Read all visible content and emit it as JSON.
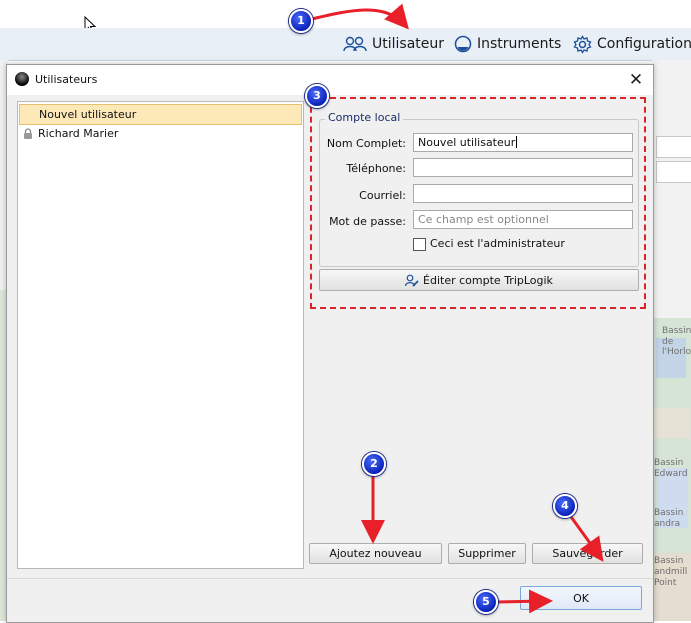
{
  "app_toolbar": {
    "items": [
      {
        "label": "Utilisateur",
        "icon": "users-icon"
      },
      {
        "label": "Instruments",
        "icon": "instrument-icon"
      },
      {
        "label": "Configuration",
        "icon": "gear-icon"
      }
    ]
  },
  "dialog": {
    "title": "Utilisateurs",
    "close_icon": "close-icon",
    "users": [
      {
        "name": "Nouvel utilisateur",
        "selected": true
      },
      {
        "name": "Richard Marier",
        "locked": true
      }
    ],
    "group_label": "Compte local",
    "fields": {
      "full_name": {
        "label": "Nom Complet:",
        "value": "Nouvel utilisateur"
      },
      "phone": {
        "label": "Téléphone:",
        "value": ""
      },
      "email": {
        "label": "Courriel:",
        "value": ""
      },
      "password": {
        "label": "Mot de passe:",
        "placeholder": "Ce champ est optionnel"
      }
    },
    "admin_checkbox": {
      "label": "Ceci est l'administrateur",
      "checked": false
    },
    "edit_triplogik_button": "Éditer compte TripLogik",
    "add_button": "Ajoutez nouveau",
    "delete_button": "Supprimer",
    "save_button": "Sauvegarder",
    "ok_button": "OK"
  },
  "callouts": [
    "1",
    "2",
    "3",
    "4",
    "5"
  ],
  "map_labels": [
    "Bassin",
    "de l'Horlo",
    "Bassin",
    "Edward",
    "Bassin",
    "andra",
    "Bassin",
    "andmill",
    "Point"
  ],
  "colors": {
    "callout": "#1a35d6",
    "arrow": "#e8202a",
    "selection": "#fde8b8",
    "toolbar": "#e8eff7"
  }
}
